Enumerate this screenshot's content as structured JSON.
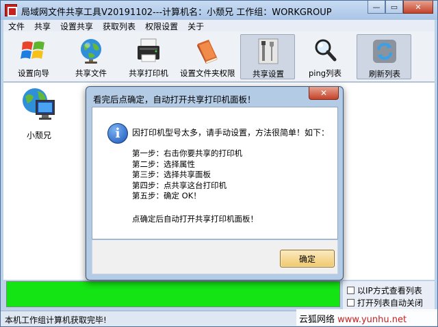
{
  "window": {
    "title": "局域网文件共享工具V20191102---计算机名：小颓兄  工作组：WORKGROUP",
    "minimize_glyph": "—",
    "maximize_glyph": "▭",
    "close_glyph": "✕"
  },
  "menu": [
    "文件",
    "共享",
    "设置共享",
    "获取列表",
    "权限设置",
    "关于"
  ],
  "toolbar": [
    {
      "label": "设置向导",
      "icon": "windows-logo-icon"
    },
    {
      "label": "共享文件",
      "icon": "globe-icon"
    },
    {
      "label": "共享打印机",
      "icon": "printer-icon"
    },
    {
      "label": "设置文件夹权限",
      "icon": "book-icon"
    },
    {
      "label": "共享设置",
      "icon": "tools-icon"
    },
    {
      "label": "ping列表",
      "icon": "magnifier-icon"
    },
    {
      "label": "刷新列表",
      "icon": "refresh-icon"
    }
  ],
  "computers": [
    {
      "label": "小颓兄",
      "icon": "network-computer-icon"
    }
  ],
  "options": {
    "view_by_ip": "以IP方式查看列表",
    "auto_close": "打开列表自动关闭"
  },
  "status": {
    "text": "本机工作组计算机获取完毕!"
  },
  "watermark": {
    "brand": "云狐网络",
    "url": "www.yunhu.net"
  },
  "dialog": {
    "title": "看完后点确定，自动打开共享打印机面板！",
    "close_glyph": "✕",
    "icon_glyph": "i",
    "message": "因打印机型号太多，请手动设置，方法很简单！如下：",
    "steps": [
      "第一步：右击你要共享的打印机",
      "第二步：选择属性",
      "第三步：选择共享面板",
      "第四步：点共享这台打印机",
      "第五步：确定   OK！"
    ],
    "footer": "点确定后自动打开共享打印机面板！",
    "ok_label": "确定"
  },
  "colors": {
    "status_fill": "#14e314",
    "window_frame": "#bcd1ea",
    "close_button": "#c4432a",
    "ok_button": "#f0c96b"
  }
}
